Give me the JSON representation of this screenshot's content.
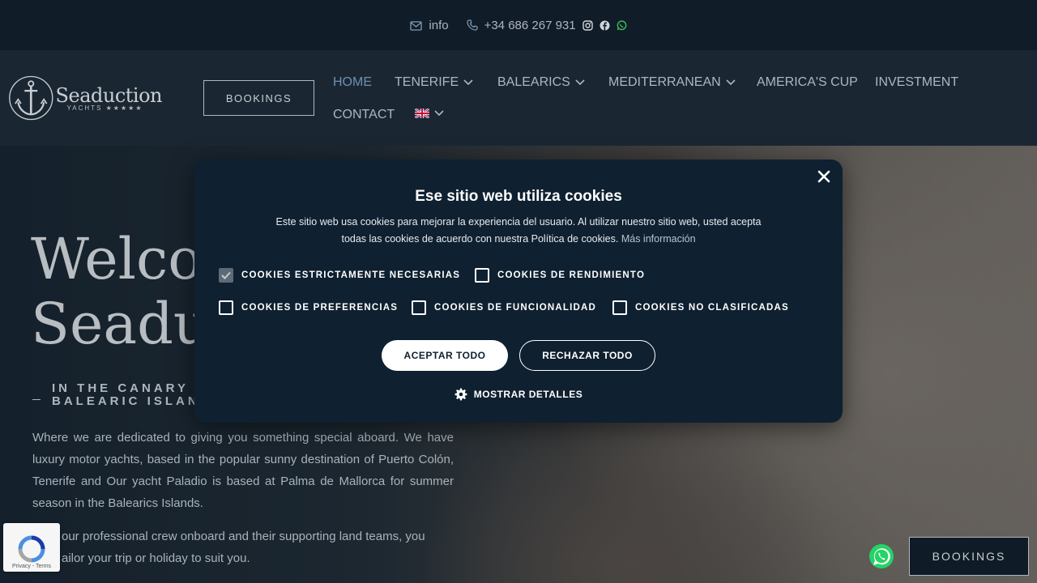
{
  "topbar": {
    "email_label": "info",
    "phone_label": "+34 686 267 931",
    "icons": [
      "envelope-icon",
      "phone-icon",
      "instagram-icon",
      "facebook-icon",
      "whatsapp-icon"
    ]
  },
  "header": {
    "logo_name": "Seaduction",
    "logo_sub": "YACHTS ★★★★★",
    "bookings_label": "BOOKINGS",
    "nav": [
      {
        "label": "HOME",
        "active": true
      },
      {
        "label": "TENERIFE",
        "dropdown": true
      },
      {
        "label": "BALEARICS",
        "dropdown": true
      },
      {
        "label": "MEDITERRANEAN",
        "dropdown": true
      },
      {
        "label": "AMERICA'S CUP"
      },
      {
        "label": "INVESTMENT"
      },
      {
        "label": "CONTACT"
      }
    ],
    "language": "uk-flag"
  },
  "hero": {
    "title_line1": "Welcome to",
    "title_line2": "Seaduction",
    "sub_line1": "IN THE CANARY",
    "sub_line2": "BALEARIC ISLAN",
    "paragraph1": "Where we are dedicated to giving you something special aboard. We have luxury motor yachts, based in the popular sunny destination of Puerto Colón, Tenerife and Our yacht Paladio is based at Palma de Mallorca for summer season in the Balearics Islands.",
    "paragraph2": "our professional crew onboard and their supporting land teams, you",
    "paragraph3": "ailor your trip or holiday to suit you."
  },
  "cookie_modal": {
    "title": "Ese sitio web utiliza cookies",
    "text": "Este sitio web usa cookies para mejorar la experiencia del usuario. Al utilizar nuestro sitio web, usted acepta todas las cookies de acuerdo con nuestra Política de cookies.",
    "more_link": "Más información",
    "options": [
      {
        "label": "COOKIES ESTRICTAMENTE NECESARIAS",
        "checked": true
      },
      {
        "label": "COOKIES DE RENDIMIENTO",
        "checked": false
      },
      {
        "label": "COOKIES DE PREFERENCIAS",
        "checked": false
      },
      {
        "label": "COOKIES DE FUNCIONALIDAD",
        "checked": false
      },
      {
        "label": "COOKIES NO CLASIFICADAS",
        "checked": false
      }
    ],
    "accept_label": "ACEPTAR TODO",
    "reject_label": "RECHAZAR TODO",
    "details_label": "MOSTRAR DETALLES"
  },
  "recaptcha": {
    "links": "Privacy - Terms"
  },
  "floating": {
    "bookings_label": "BOOKINGS"
  },
  "colors": {
    "accent_nav": "#6f8fad",
    "modal_bg": "#0f2030",
    "whatsapp": "#25d366"
  }
}
